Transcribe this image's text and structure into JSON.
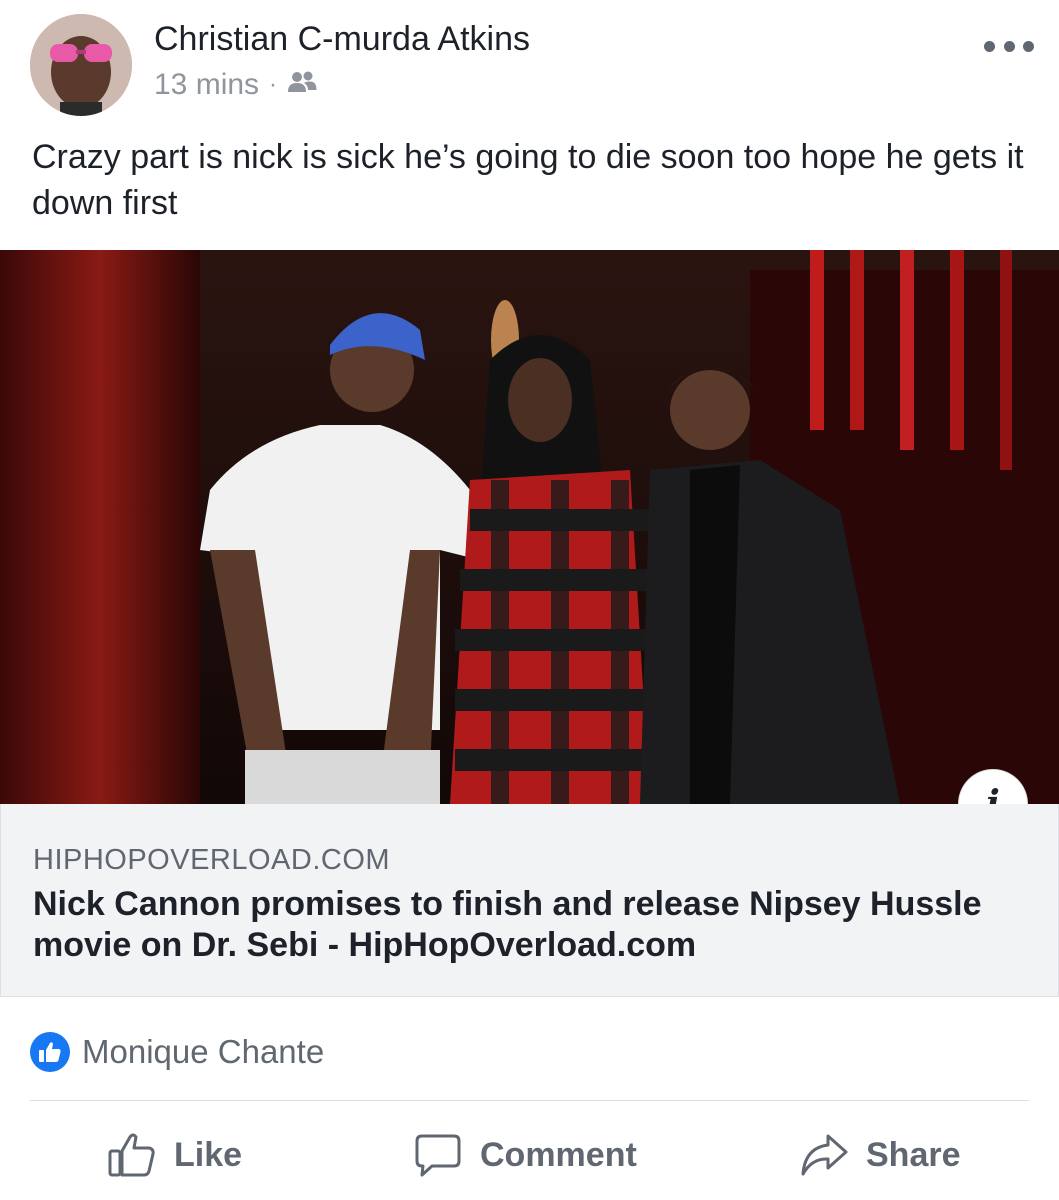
{
  "post": {
    "author": "Christian C-murda Atkins",
    "time": "13 mins",
    "separator": "·",
    "audience_icon": "friends-icon",
    "text": "Crazy part is nick is sick he’s going to die soon too hope he gets it down first"
  },
  "link_preview": {
    "domain": "HIPHOPOVERLOAD.COM",
    "title": "Nick Cannon promises to finish and release Nipsey Hussle movie on Dr. Sebi - HipHopOverload.com",
    "info_label": "i"
  },
  "reactions": {
    "icon": "like-icon",
    "names": "Monique Chante"
  },
  "actions": {
    "like": "Like",
    "comment": "Comment",
    "share": "Share"
  },
  "colors": {
    "accent": "#1877f2",
    "secondary_text": "#606770",
    "link_box_bg": "#f2f3f5"
  }
}
